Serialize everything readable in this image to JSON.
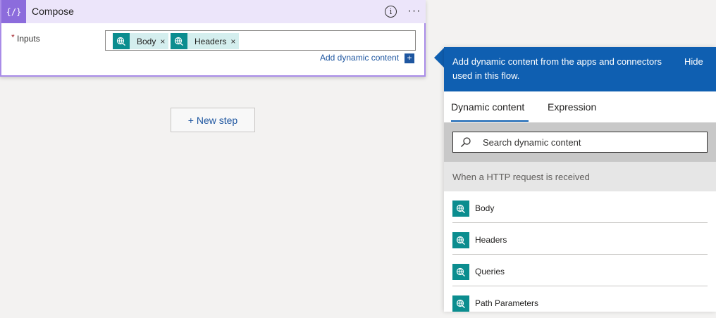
{
  "card": {
    "icon_glyph": "{/}",
    "title": "Compose",
    "info_glyph": "i",
    "more_glyph": "···",
    "required_marker": "*",
    "inputs_label": "Inputs",
    "tokens": [
      {
        "label": "Body",
        "remove": "×"
      },
      {
        "label": "Headers",
        "remove": "×"
      }
    ],
    "add_dynamic_label": "Add dynamic content",
    "add_dynamic_glyph": "+",
    "accent_color": "#8c6cdc",
    "token_icon_color": "#0b8d8f"
  },
  "new_step": {
    "label": "+ New step"
  },
  "panel": {
    "header_text": "Add dynamic content from the apps and connectors used in this flow.",
    "hide_label": "Hide",
    "header_color": "#0f5fb1",
    "tabs": [
      {
        "label": "Dynamic content",
        "active": true
      },
      {
        "label": "Expression",
        "active": false
      }
    ],
    "search_placeholder": "Search dynamic content",
    "section_title": "When a HTTP request is received",
    "items": [
      {
        "label": "Body",
        "icon": "http-request-icon"
      },
      {
        "label": "Headers",
        "icon": "http-request-icon"
      },
      {
        "label": "Queries",
        "icon": "http-request-icon"
      },
      {
        "label": "Path Parameters",
        "icon": "http-request-icon"
      }
    ]
  }
}
